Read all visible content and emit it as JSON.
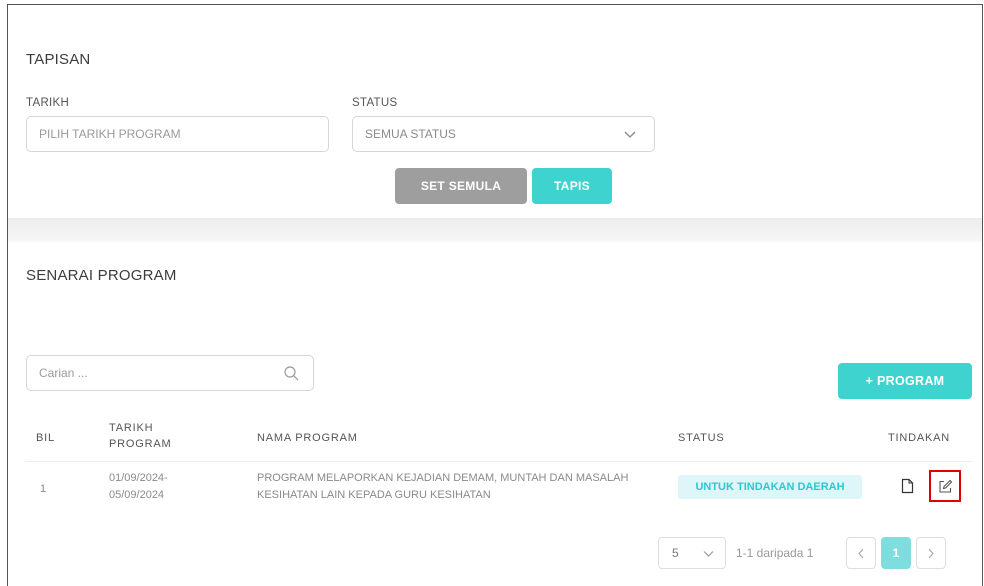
{
  "filter": {
    "title": "TAPISAN",
    "date_label": "TARIKH",
    "date_placeholder": "PILIH TARIKH PROGRAM",
    "status_label": "STATUS",
    "status_value": "SEMUA STATUS",
    "reset_label": "SET SEMULA",
    "filter_label": "TAPIS"
  },
  "list": {
    "title": "SENARAI PROGRAM",
    "search_placeholder": "Carian ...",
    "add_label": "+ PROGRAM",
    "columns": [
      "BIL",
      "TARIKH PROGRAM",
      "NAMA PROGRAM",
      "STATUS",
      "TINDAKAN"
    ],
    "rows": [
      {
        "no": "1",
        "date": "01/09/2024- 05/09/2024",
        "name": "PROGRAM MELAPORKAN KEJADIAN DEMAM, MUNTAH DAN MASALAH KESIHATAN LAIN KEPADA GURU KESIHATAN",
        "status": "UNTUK TINDAKAN DAERAH"
      }
    ]
  },
  "pagination": {
    "page_size": "5",
    "range": "1-1 daripada 1",
    "current_page": "1"
  },
  "colors": {
    "accent": "#3fd3cf",
    "reset": "#9e9e9e",
    "highlight": "#e00000"
  },
  "icons": [
    "chevron-down-icon",
    "search-icon",
    "document-icon",
    "edit-icon",
    "chevron-left-icon",
    "chevron-right-icon"
  ]
}
